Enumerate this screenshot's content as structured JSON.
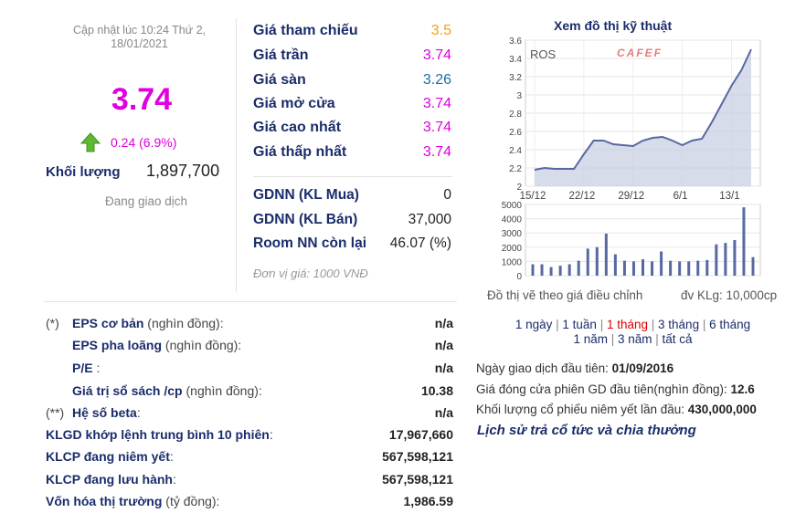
{
  "update_text": "Cập nhật lúc 10:24 Thứ 2, 18/01/2021",
  "current_price": "3.74",
  "change": "0.24 (6.9%)",
  "volume": {
    "label": "Khối lượng",
    "value": "1,897,700"
  },
  "status": "Đang giao dịch",
  "prices": [
    {
      "label": "Giá tham chiếu",
      "value": "3.5",
      "color": "#f0a020"
    },
    {
      "label": "Giá trần",
      "value": "3.74",
      "color": "#e000e0"
    },
    {
      "label": "Giá sàn",
      "value": "3.26",
      "color": "#1a6fa0"
    },
    {
      "label": "Giá mở cửa",
      "value": "3.74",
      "color": "#e000e0"
    },
    {
      "label": "Giá cao nhất",
      "value": "3.74",
      "color": "#e000e0"
    },
    {
      "label": "Giá thấp nhất",
      "value": "3.74",
      "color": "#e000e0"
    }
  ],
  "foreign": [
    {
      "label": "GDNN (KL Mua)",
      "value": "0"
    },
    {
      "label": "GDNN (KL Bán)",
      "value": "37,000"
    },
    {
      "label": "Room NN còn lại",
      "value": "46.07 (%)"
    }
  ],
  "unit_note": "Đơn vị giá: 1000 VNĐ",
  "fundamentals": [
    {
      "prefix": "(*)",
      "bold": "EPS cơ bản",
      "normal": " (nghìn đồng):",
      "value": "n/a"
    },
    {
      "prefix": "",
      "bold": "EPS pha loãng",
      "normal": " (nghìn đồng):",
      "value": "n/a"
    },
    {
      "prefix": "",
      "bold": "P/E",
      "normal": " :",
      "value": "n/a"
    },
    {
      "prefix": "",
      "bold": "Giá trị sổ sách /cp",
      "normal": " (nghìn đồng):",
      "value": "10.38"
    },
    {
      "prefix": "(**)",
      "bold": "Hệ số beta",
      "normal": ":",
      "value": "n/a"
    },
    {
      "prefix": "",
      "bold": "KLGD khớp lệnh trung bình 10 phiên",
      "normal": ":",
      "value": "17,967,660"
    },
    {
      "prefix": "",
      "bold": "KLCP đang niêm yết",
      "normal": ":",
      "value": "567,598,121"
    },
    {
      "prefix": "",
      "bold": "KLCP đang lưu hành",
      "normal": ":",
      "value": "567,598,121"
    },
    {
      "prefix": "",
      "bold": "Vốn hóa thị trường",
      "normal": " (tỷ đồng):",
      "value": "1,986.59"
    }
  ],
  "chart_title": "Xem đồ thị kỹ thuật",
  "chart_data": {
    "type": "line",
    "ticker": "ROS",
    "watermark": "CAFEF",
    "price_axis": {
      "ylim": [
        2,
        3.6
      ],
      "ticks": [
        "3.6",
        "3.4",
        "3.2",
        "3",
        "2.8",
        "2.6",
        "2.4",
        "2.2",
        "2"
      ]
    },
    "volume_axis": {
      "ylim": [
        0,
        5000
      ],
      "ticks": [
        "5000",
        "4000",
        "3000",
        "2000",
        "1000",
        "0"
      ]
    },
    "x_tick_labels": [
      "15/12",
      "22/12",
      "29/12",
      "6/1",
      "13/1"
    ],
    "price": [
      2.18,
      2.2,
      2.19,
      2.19,
      2.19,
      2.35,
      2.5,
      2.5,
      2.46,
      2.45,
      2.44,
      2.5,
      2.53,
      2.54,
      2.5,
      2.45,
      2.5,
      2.52,
      2.7,
      2.9,
      3.1,
      3.27,
      3.5
    ],
    "volume": [
      800,
      800,
      600,
      700,
      800,
      1050,
      1900,
      2000,
      2950,
      1500,
      1050,
      1000,
      1150,
      1000,
      1700,
      1050,
      1000,
      1000,
      1050,
      1100,
      2200,
      2300,
      2500,
      4800,
      1300
    ]
  },
  "chart_note": "Đồ thị vẽ theo giá điều chỉnh",
  "volume_unit": "đv KLg: 10,000cp",
  "periods": [
    {
      "label": "1 ngày",
      "active": false
    },
    {
      "label": "1 tuần",
      "active": false
    },
    {
      "label": "1 tháng",
      "active": true
    },
    {
      "label": "3 tháng",
      "active": false
    },
    {
      "label": "6 tháng",
      "active": false
    },
    {
      "label": "1 năm",
      "active": false
    },
    {
      "label": "3 năm",
      "active": false
    },
    {
      "label": "tất cả",
      "active": false
    }
  ],
  "info": [
    {
      "label": "Ngày giao dịch đầu tiên: ",
      "value": "01/09/2016"
    },
    {
      "label": "Giá đóng cửa phiên GD đầu tiên(nghìn đồng): ",
      "value": "12.6"
    },
    {
      "label": "Khối lượng cổ phiếu niêm yết lần đầu: ",
      "value": "430,000,000"
    }
  ],
  "history_link": "Lịch sử trả cổ tức và chia thưởng"
}
